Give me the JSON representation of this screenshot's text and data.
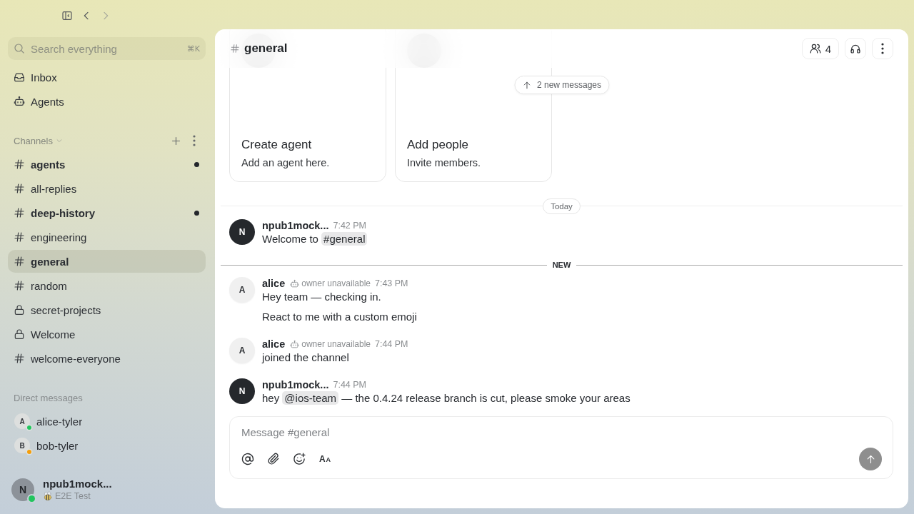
{
  "sidebar": {
    "toolbar": {
      "back_disabled": false,
      "forward_disabled": true
    },
    "search": {
      "placeholder": "Search everything",
      "shortcut": "⌘K"
    },
    "nav": [
      {
        "kind": "inbox",
        "label": "Inbox"
      },
      {
        "kind": "agents",
        "label": "Agents"
      }
    ],
    "channels_heading": "Channels",
    "channels": [
      {
        "kind": "public",
        "name": "agents",
        "unread": true,
        "selected": false
      },
      {
        "kind": "public",
        "name": "all-replies",
        "unread": false,
        "selected": false
      },
      {
        "kind": "public",
        "name": "deep-history",
        "unread": true,
        "selected": false
      },
      {
        "kind": "public",
        "name": "engineering",
        "unread": false,
        "selected": false
      },
      {
        "kind": "public",
        "name": "general",
        "unread": false,
        "selected": true
      },
      {
        "kind": "public",
        "name": "random",
        "unread": false,
        "selected": false
      },
      {
        "kind": "private",
        "name": "secret-projects",
        "unread": false,
        "selected": false
      },
      {
        "kind": "private",
        "name": "Welcome",
        "unread": false,
        "selected": false
      },
      {
        "kind": "public",
        "name": "welcome-everyone",
        "unread": false,
        "selected": false
      }
    ],
    "dm_heading": "Direct messages",
    "direct_messages": [
      {
        "name": "alice-tyler",
        "initial": "A",
        "color": "#22c55e"
      },
      {
        "name": "bob-tyler",
        "initial": "B",
        "color": "#f59e0b"
      }
    ],
    "user": {
      "name": "npub1mock...",
      "initial": "N",
      "status": "E2E Test",
      "color": "#22c55e"
    }
  },
  "channel_header": {
    "kind": "public",
    "title": "general",
    "member_count": "4"
  },
  "new_messages_pill": "2 new messages",
  "cards": [
    {
      "title": "Create agent",
      "text": "Add an agent here."
    },
    {
      "title": "Add people",
      "text": "Invite members."
    }
  ],
  "timeline": [
    {
      "kind": "day",
      "label": "Today"
    },
    {
      "kind": "message",
      "author": "npub1mock...",
      "agent": false,
      "initial": "N",
      "time": "7:42 PM",
      "paragraphs": [
        [
          {
            "kind": "text",
            "text": "Welcome to "
          },
          {
            "kind": "channel",
            "text": "#general"
          }
        ]
      ]
    },
    {
      "kind": "unread",
      "label": "NEW"
    },
    {
      "kind": "message",
      "author": "alice",
      "agent": true,
      "initial": "A",
      "badge": "owner unavailable",
      "time": "7:43 PM",
      "paragraphs": [
        [
          {
            "kind": "text",
            "text": "Hey team — checking in."
          }
        ],
        [
          {
            "kind": "text",
            "text": "React to me with a custom emoji"
          }
        ]
      ]
    },
    {
      "kind": "message",
      "author": "alice",
      "agent": true,
      "initial": "A",
      "badge": "owner unavailable",
      "time": "7:44 PM",
      "paragraphs": [
        [
          {
            "kind": "text",
            "text": "joined the channel"
          }
        ]
      ]
    },
    {
      "kind": "message",
      "author": "npub1mock...",
      "agent": false,
      "initial": "N",
      "time": "7:44 PM",
      "paragraphs": [
        [
          {
            "kind": "text",
            "text": "hey "
          },
          {
            "kind": "user",
            "text": "@ios-team"
          },
          {
            "kind": "text",
            "text": " — the 0.4.24 release branch is cut, please smoke your areas"
          }
        ]
      ]
    }
  ],
  "composer": {
    "placeholder": "Message #general",
    "format_label": [
      "A",
      "A"
    ],
    "send_disabled": true
  }
}
